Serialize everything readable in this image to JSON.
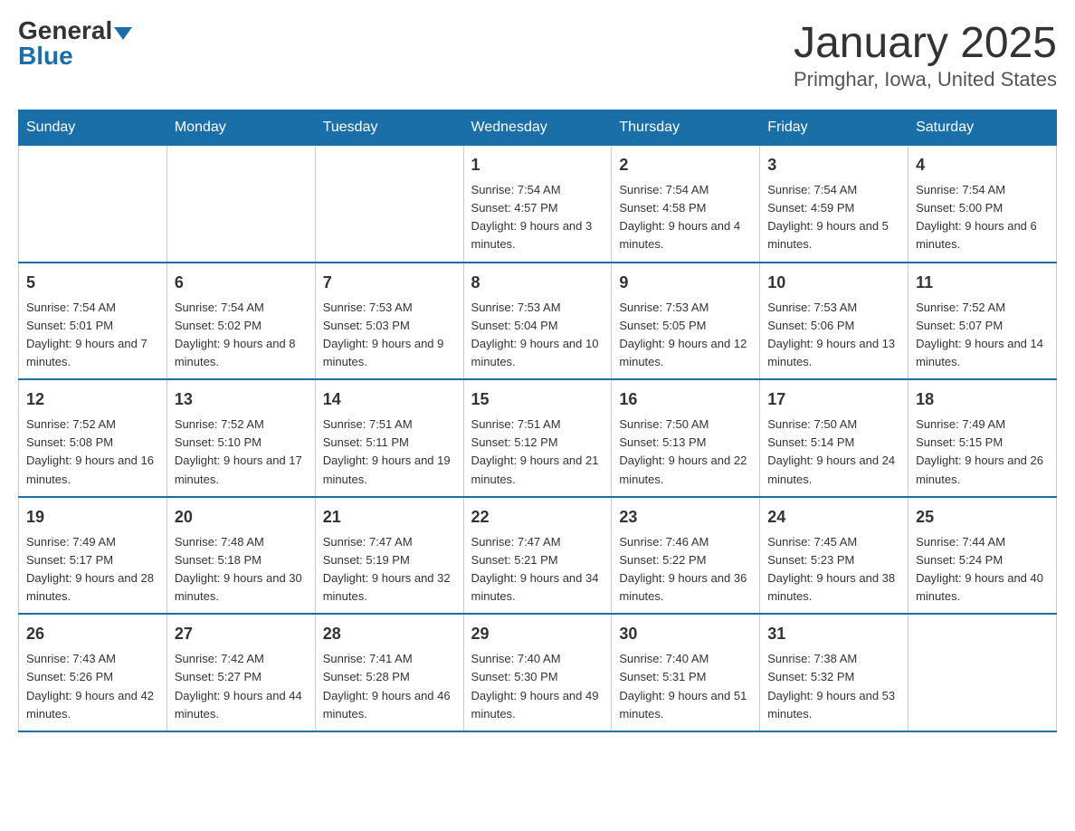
{
  "header": {
    "logo_general": "General",
    "logo_blue": "Blue",
    "main_title": "January 2025",
    "subtitle": "Primghar, Iowa, United States"
  },
  "calendar": {
    "days_of_week": [
      "Sunday",
      "Monday",
      "Tuesday",
      "Wednesday",
      "Thursday",
      "Friday",
      "Saturday"
    ],
    "weeks": [
      [
        {
          "day": "",
          "info": ""
        },
        {
          "day": "",
          "info": ""
        },
        {
          "day": "",
          "info": ""
        },
        {
          "day": "1",
          "info": "Sunrise: 7:54 AM\nSunset: 4:57 PM\nDaylight: 9 hours and 3 minutes."
        },
        {
          "day": "2",
          "info": "Sunrise: 7:54 AM\nSunset: 4:58 PM\nDaylight: 9 hours and 4 minutes."
        },
        {
          "day": "3",
          "info": "Sunrise: 7:54 AM\nSunset: 4:59 PM\nDaylight: 9 hours and 5 minutes."
        },
        {
          "day": "4",
          "info": "Sunrise: 7:54 AM\nSunset: 5:00 PM\nDaylight: 9 hours and 6 minutes."
        }
      ],
      [
        {
          "day": "5",
          "info": "Sunrise: 7:54 AM\nSunset: 5:01 PM\nDaylight: 9 hours and 7 minutes."
        },
        {
          "day": "6",
          "info": "Sunrise: 7:54 AM\nSunset: 5:02 PM\nDaylight: 9 hours and 8 minutes."
        },
        {
          "day": "7",
          "info": "Sunrise: 7:53 AM\nSunset: 5:03 PM\nDaylight: 9 hours and 9 minutes."
        },
        {
          "day": "8",
          "info": "Sunrise: 7:53 AM\nSunset: 5:04 PM\nDaylight: 9 hours and 10 minutes."
        },
        {
          "day": "9",
          "info": "Sunrise: 7:53 AM\nSunset: 5:05 PM\nDaylight: 9 hours and 12 minutes."
        },
        {
          "day": "10",
          "info": "Sunrise: 7:53 AM\nSunset: 5:06 PM\nDaylight: 9 hours and 13 minutes."
        },
        {
          "day": "11",
          "info": "Sunrise: 7:52 AM\nSunset: 5:07 PM\nDaylight: 9 hours and 14 minutes."
        }
      ],
      [
        {
          "day": "12",
          "info": "Sunrise: 7:52 AM\nSunset: 5:08 PM\nDaylight: 9 hours and 16 minutes."
        },
        {
          "day": "13",
          "info": "Sunrise: 7:52 AM\nSunset: 5:10 PM\nDaylight: 9 hours and 17 minutes."
        },
        {
          "day": "14",
          "info": "Sunrise: 7:51 AM\nSunset: 5:11 PM\nDaylight: 9 hours and 19 minutes."
        },
        {
          "day": "15",
          "info": "Sunrise: 7:51 AM\nSunset: 5:12 PM\nDaylight: 9 hours and 21 minutes."
        },
        {
          "day": "16",
          "info": "Sunrise: 7:50 AM\nSunset: 5:13 PM\nDaylight: 9 hours and 22 minutes."
        },
        {
          "day": "17",
          "info": "Sunrise: 7:50 AM\nSunset: 5:14 PM\nDaylight: 9 hours and 24 minutes."
        },
        {
          "day": "18",
          "info": "Sunrise: 7:49 AM\nSunset: 5:15 PM\nDaylight: 9 hours and 26 minutes."
        }
      ],
      [
        {
          "day": "19",
          "info": "Sunrise: 7:49 AM\nSunset: 5:17 PM\nDaylight: 9 hours and 28 minutes."
        },
        {
          "day": "20",
          "info": "Sunrise: 7:48 AM\nSunset: 5:18 PM\nDaylight: 9 hours and 30 minutes."
        },
        {
          "day": "21",
          "info": "Sunrise: 7:47 AM\nSunset: 5:19 PM\nDaylight: 9 hours and 32 minutes."
        },
        {
          "day": "22",
          "info": "Sunrise: 7:47 AM\nSunset: 5:21 PM\nDaylight: 9 hours and 34 minutes."
        },
        {
          "day": "23",
          "info": "Sunrise: 7:46 AM\nSunset: 5:22 PM\nDaylight: 9 hours and 36 minutes."
        },
        {
          "day": "24",
          "info": "Sunrise: 7:45 AM\nSunset: 5:23 PM\nDaylight: 9 hours and 38 minutes."
        },
        {
          "day": "25",
          "info": "Sunrise: 7:44 AM\nSunset: 5:24 PM\nDaylight: 9 hours and 40 minutes."
        }
      ],
      [
        {
          "day": "26",
          "info": "Sunrise: 7:43 AM\nSunset: 5:26 PM\nDaylight: 9 hours and 42 minutes."
        },
        {
          "day": "27",
          "info": "Sunrise: 7:42 AM\nSunset: 5:27 PM\nDaylight: 9 hours and 44 minutes."
        },
        {
          "day": "28",
          "info": "Sunrise: 7:41 AM\nSunset: 5:28 PM\nDaylight: 9 hours and 46 minutes."
        },
        {
          "day": "29",
          "info": "Sunrise: 7:40 AM\nSunset: 5:30 PM\nDaylight: 9 hours and 49 minutes."
        },
        {
          "day": "30",
          "info": "Sunrise: 7:40 AM\nSunset: 5:31 PM\nDaylight: 9 hours and 51 minutes."
        },
        {
          "day": "31",
          "info": "Sunrise: 7:38 AM\nSunset: 5:32 PM\nDaylight: 9 hours and 53 minutes."
        },
        {
          "day": "",
          "info": ""
        }
      ]
    ]
  }
}
